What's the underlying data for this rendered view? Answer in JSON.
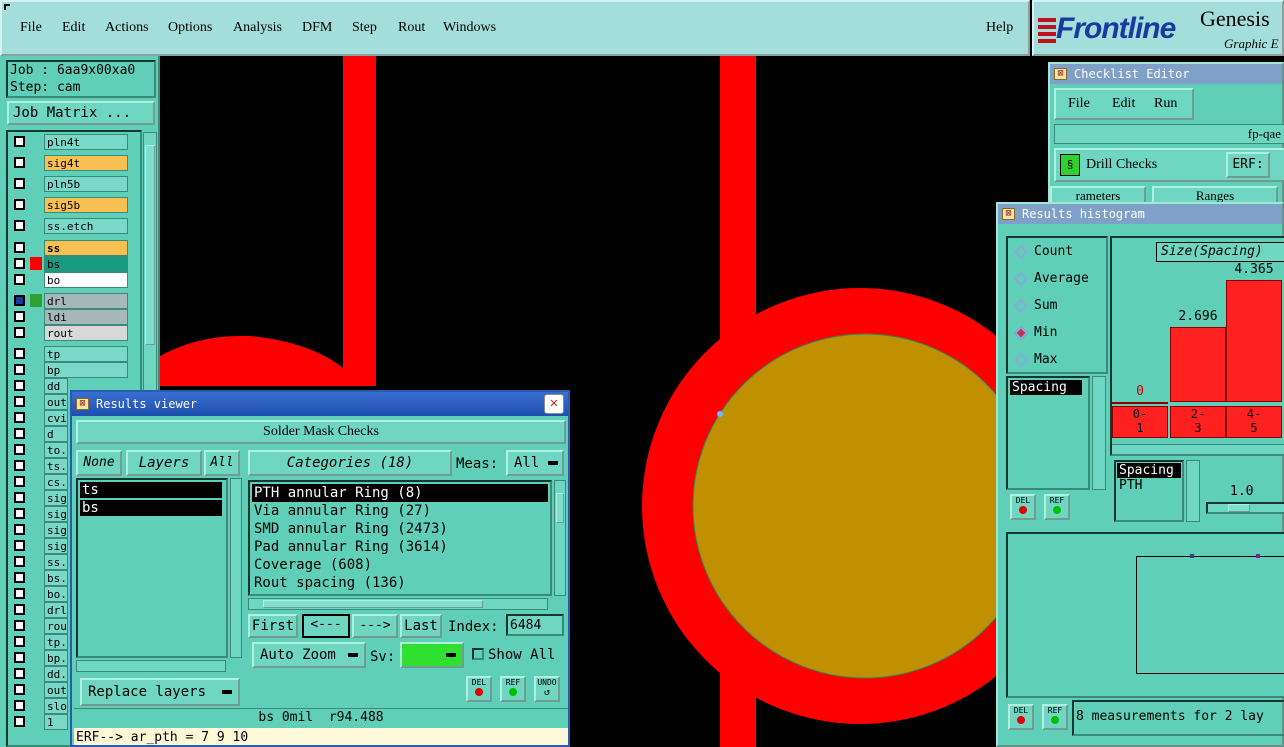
{
  "menubar": {
    "items": [
      {
        "label": "File",
        "u": "F"
      },
      {
        "label": "Edit",
        "u": "E"
      },
      {
        "label": "Actions",
        "u": "A"
      },
      {
        "label": "Options",
        "u": "O"
      },
      {
        "label": "Analysis",
        "u": ""
      },
      {
        "label": "DFM",
        "u": ""
      },
      {
        "label": "Step",
        "u": "S"
      },
      {
        "label": "Rout",
        "u": "R"
      },
      {
        "label": "Windows",
        "u": "W"
      }
    ],
    "help": "Help"
  },
  "logo": {
    "brand": "Frontline",
    "product": "Genesis",
    "subtitle": "Graphic E"
  },
  "left": {
    "job": "Job : 6aa9x00xa0",
    "step": "Step: cam",
    "matrix_button": "Job Matrix ...",
    "layers": [
      {
        "name": "pln4t",
        "color": "#7ad8c8"
      },
      {
        "name": "sig4t",
        "color": "#f8c050"
      },
      {
        "name": "pln5b",
        "color": "#7ad8c8"
      },
      {
        "name": "sig5b",
        "color": "#f8c050"
      },
      {
        "name": "ss.etch",
        "color": "#7ad8c8"
      },
      {
        "name": "ss",
        "color": "#f8c050"
      },
      {
        "name": "bs",
        "color": "#1a9a80"
      },
      {
        "name": "bo",
        "color": "#ffffff"
      },
      {
        "name": "drl",
        "color": "#a8b8b8"
      },
      {
        "name": "ldi",
        "color": "#a8b8b8"
      },
      {
        "name": "rout",
        "color": "#d8d8d8"
      },
      {
        "name": "tp",
        "color": "#7ad8c8"
      },
      {
        "name": "bp",
        "color": "#7ad8c8"
      },
      {
        "name": "dd",
        "color": "#7ad8c8"
      },
      {
        "name": "out",
        "color": "#7ad8c8"
      },
      {
        "name": "cvi",
        "color": "#7ad8c8"
      },
      {
        "name": "d",
        "color": "#7ad8c8"
      },
      {
        "name": "to.",
        "color": "#7ad8c8"
      },
      {
        "name": "ts.",
        "color": "#7ad8c8"
      },
      {
        "name": "cs.",
        "color": "#7ad8c8"
      },
      {
        "name": "sig",
        "color": "#7ad8c8"
      },
      {
        "name": "sig",
        "color": "#7ad8c8"
      },
      {
        "name": "sig",
        "color": "#7ad8c8"
      },
      {
        "name": "sig",
        "color": "#7ad8c8"
      },
      {
        "name": "ss.",
        "color": "#7ad8c8"
      },
      {
        "name": "bs.",
        "color": "#7ad8c8"
      },
      {
        "name": "bo.",
        "color": "#7ad8c8"
      },
      {
        "name": "drl",
        "color": "#7ad8c8"
      },
      {
        "name": "rou",
        "color": "#7ad8c8"
      },
      {
        "name": "tp.",
        "color": "#7ad8c8"
      },
      {
        "name": "bp.",
        "color": "#7ad8c8"
      },
      {
        "name": "dd.",
        "color": "#7ad8c8"
      },
      {
        "name": "out",
        "color": "#7ad8c8"
      },
      {
        "name": "slo",
        "color": "#7ad8c8"
      },
      {
        "name": "1",
        "color": "#7ad8c8"
      }
    ]
  },
  "results_viewer": {
    "title": "Results viewer",
    "header": "Solder Mask Checks",
    "none": "None",
    "layers": "Layers",
    "all": "All",
    "categories": "Categories (18)",
    "meas_label": "Meas:",
    "meas_value": "All",
    "layer_list": [
      "ts",
      "bs"
    ],
    "category_list": [
      "PTH annular Ring (8)",
      "Via annular Ring (27)",
      "SMD annular Ring (2473)",
      "Pad annular Ring (3614)",
      "Coverage (608)",
      "Rout spacing (136)"
    ],
    "first": "First",
    "prev": "<---",
    "next": "--->",
    "last": "Last",
    "index_label": "Index:",
    "index_value": "6484",
    "auto_zoom": "Auto Zoom",
    "sv_label": "Sv:",
    "show_all": "Show All",
    "replace_layers": "Replace layers",
    "del": "DEL",
    "ref": "REF",
    "undo": "UNDO",
    "status": "bs 0mil  r94.488",
    "erf": "ERF--> ar_pth = 7 9 10"
  },
  "checklist": {
    "title": "Checklist Editor",
    "menu": [
      "File",
      "Edit",
      "Run"
    ],
    "name": "fp-qae",
    "check": "Drill Checks",
    "erf": "ERF:",
    "tab1": "rameters",
    "tab2": "Ranges"
  },
  "histogram": {
    "title": "Results histogram",
    "options": [
      "Count",
      "Average",
      "Sum",
      "Min",
      "Max"
    ],
    "selected": "Min",
    "list": [
      "Spacing"
    ],
    "chart_title": "Size(Spacing)",
    "bars": [
      {
        "value": "0",
        "label": "0-\n1"
      },
      {
        "value": "2.696",
        "label": "2-\n3"
      },
      {
        "value": "4.365",
        "label": "4-\n5"
      }
    ],
    "list2": [
      "Spacing",
      "PTH"
    ],
    "slider_value": "1.0",
    "footer": "8 measurements for 2 lay",
    "del": "DEL",
    "ref": "REF"
  }
}
